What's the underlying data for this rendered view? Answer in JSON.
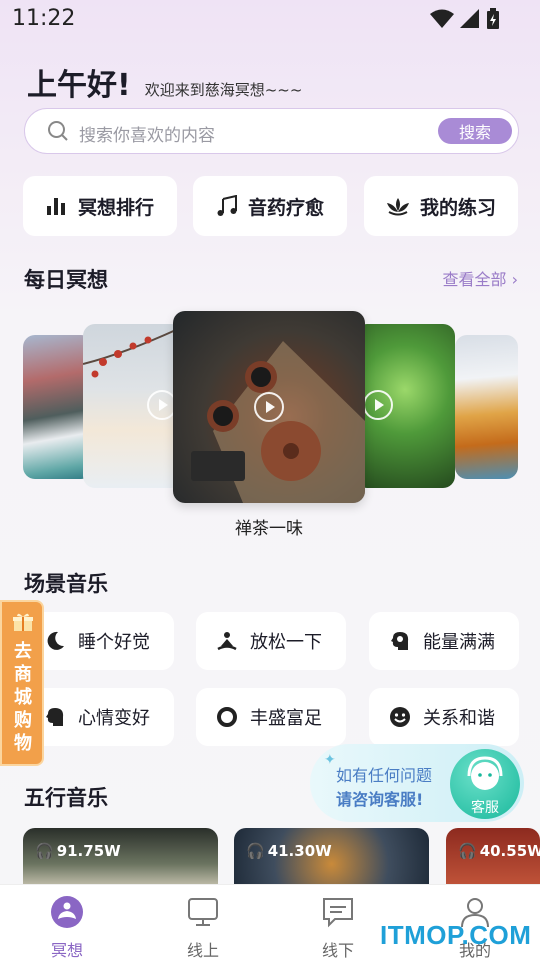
{
  "status_bar": {
    "time": "11:22"
  },
  "header": {
    "greeting": "上午好!",
    "welcome": "欢迎来到慈海冥想~~~"
  },
  "search": {
    "placeholder": "搜索你喜欢的内容",
    "button_label": "搜索"
  },
  "quick_links": [
    {
      "label": "冥想排行",
      "icon": "bar-chart-icon"
    },
    {
      "label": "音药疗愈",
      "icon": "music-note-icon"
    },
    {
      "label": "我的练习",
      "icon": "lotus-icon"
    }
  ],
  "daily": {
    "title": "每日冥想",
    "see_all": "查看全部",
    "featured_caption": "禅茶一味"
  },
  "scenes": {
    "title": "场景音乐",
    "items": [
      {
        "label": "睡个好觉",
        "icon": "moon-icon"
      },
      {
        "label": "放松一下",
        "icon": "meditation-icon"
      },
      {
        "label": "能量满满",
        "icon": "brain-icon"
      },
      {
        "label": "心情变好",
        "icon": "head-icon"
      },
      {
        "label": "丰盛富足",
        "icon": "circle-icon"
      },
      {
        "label": "关系和谐",
        "icon": "smile-icon"
      }
    ]
  },
  "shop_tab": {
    "label": "去商城购物"
  },
  "service": {
    "line1": "如有任何问题",
    "line2": "请咨询客服!",
    "avatar_label": "客服"
  },
  "wuxing": {
    "title": "五行音乐",
    "items": [
      {
        "count": "91.75W"
      },
      {
        "count": "41.30W"
      },
      {
        "count": "40.55W"
      }
    ]
  },
  "nav": [
    {
      "label": "冥想",
      "active": true
    },
    {
      "label": "线上"
    },
    {
      "label": "线下"
    },
    {
      "label": "我的"
    }
  ],
  "watermark": "ITMOP.COM",
  "colors": {
    "accent": "#a98bd6",
    "shop": "#f2a04a",
    "service": "#19b89c"
  }
}
